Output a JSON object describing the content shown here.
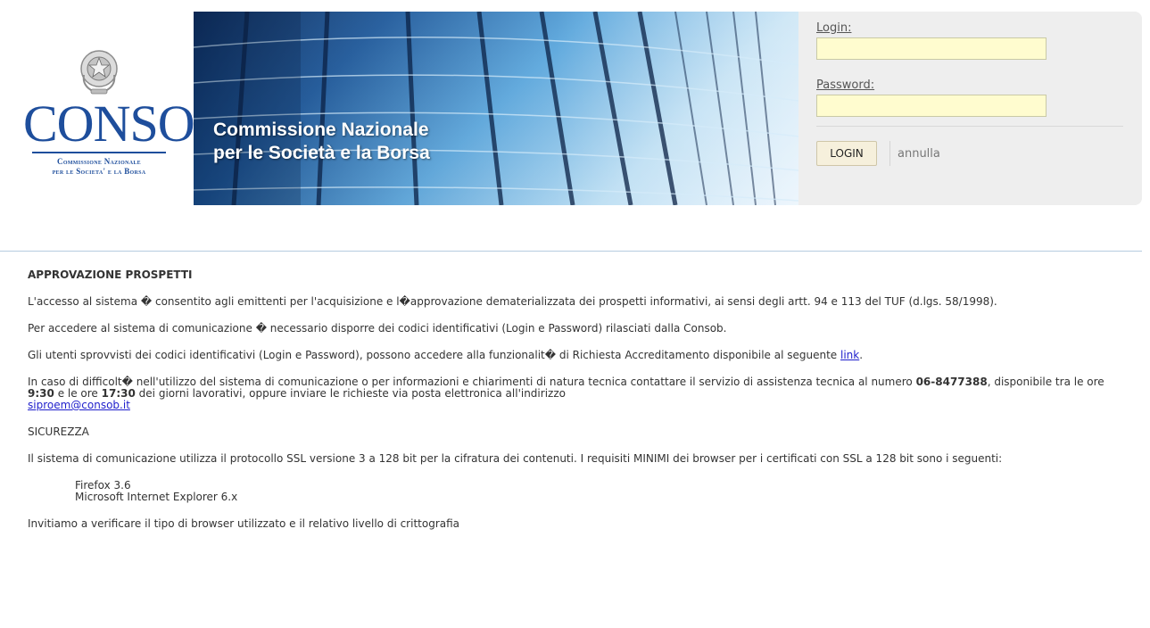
{
  "header": {
    "logo": {
      "word": "CONSOB",
      "sub_line1": "Commissione Nazionale",
      "sub_line2": "per le Societa' e la Borsa",
      "emblem": "italian-republic-emblem"
    },
    "banner": {
      "line1": "Commissione Nazionale",
      "line2": "per le Società e la Borsa"
    }
  },
  "login": {
    "login_label": "Login:",
    "login_value": "",
    "password_label": "Password:",
    "password_value": "",
    "login_button": "LOGIN",
    "cancel_link": "annulla"
  },
  "content": {
    "section_title": "APPROVAZIONE PROSPETTI",
    "p1": "L'accesso al sistema � consentito agli emittenti per l'acquisizione e l�approvazione dematerializzata dei prospetti informativi, ai sensi degli artt. 94 e 113 del TUF (d.lgs. 58/1998).",
    "p2": "Per accedere al sistema di comunicazione � necessario disporre dei codici identificativi (Login e Password) rilasciati dalla Consob.",
    "p3_text": "Gli utenti sprovvisti dei codici identificativi (Login e Password), possono accedere alla funzionalit� di Richiesta Accreditamento disponibile al seguente",
    "p3_link": "link",
    "p4_a": "In caso di difficolt� nell'utilizzo del sistema di comunicazione o per informazioni e chiarimenti di natura tecnica contattare il servizio di assistenza tecnica al numero",
    "phone": "06-8477388",
    "p4_b": ", disponibile tra le ore",
    "time_start": "9:30",
    "p4_c": "e le ore",
    "time_end": "17:30",
    "p4_d": "dei giorni lavorativi, oppure inviare le richieste via posta elettronica all'indirizzo",
    "email": "siproem@consob.it",
    "security_title": "SICUREZZA",
    "p5": "Il sistema di comunicazione utilizza il protocollo SSL versione 3 a 128 bit per la cifratura dei contenuti. I requisiti MINIMI dei browser per i certificati con SSL a 128 bit sono i seguenti:",
    "browsers": [
      "Firefox 3.6",
      "Microsoft Internet Explorer 6.x"
    ],
    "p6": "Invitiamo a verificare il tipo di browser utilizzato e il relativo livello di crittografia"
  },
  "colors": {
    "brand_blue": "#1e4e9c",
    "input_background": "#fffccf",
    "panel_background": "#eeeeee",
    "link": "#1f1fcc"
  }
}
